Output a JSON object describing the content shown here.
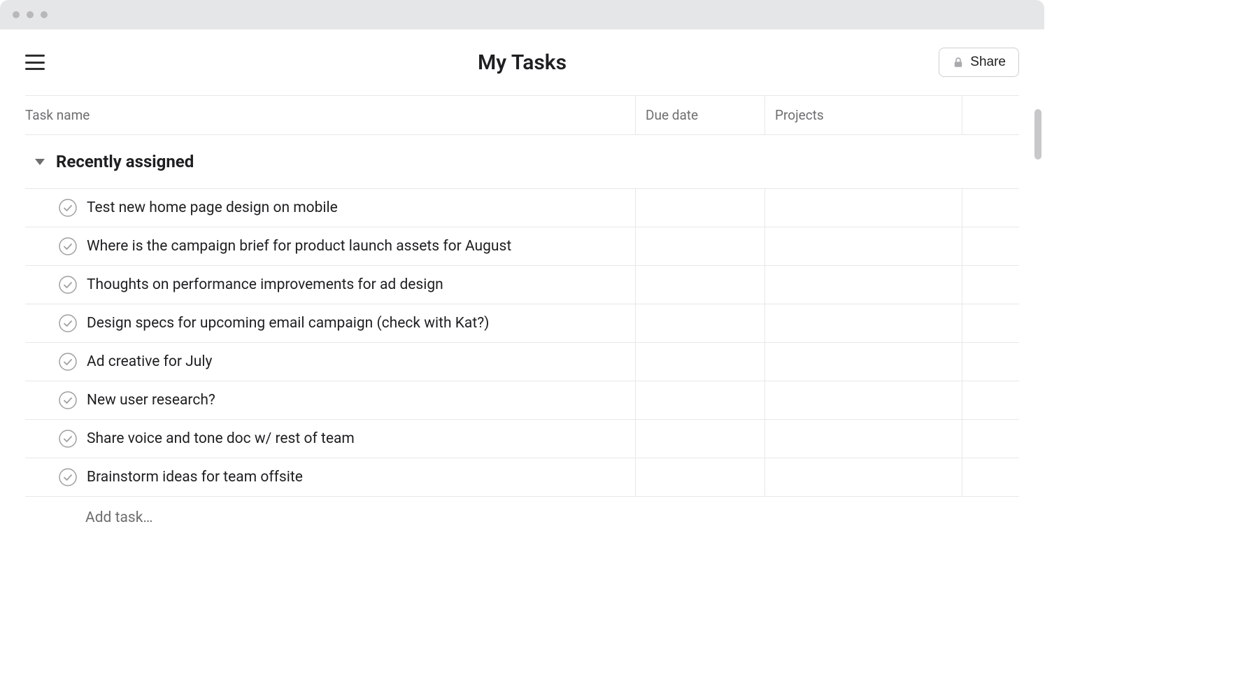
{
  "header": {
    "title": "My Tasks",
    "share_label": "Share"
  },
  "columns": {
    "task_name": "Task name",
    "due_date": "Due date",
    "projects": "Projects"
  },
  "section": {
    "title": "Recently assigned",
    "tasks": [
      {
        "name": "Test new home page design on mobile"
      },
      {
        "name": "Where is the campaign brief for product launch assets for August"
      },
      {
        "name": "Thoughts on performance improvements for ad design"
      },
      {
        "name": "Design specs for upcoming email campaign (check with Kat?)"
      },
      {
        "name": "Ad creative for July"
      },
      {
        "name": "New user research?"
      },
      {
        "name": "Share voice and tone doc w/ rest of team"
      },
      {
        "name": "Brainstorm ideas for team offsite"
      }
    ]
  },
  "add_task_placeholder": "Add task…"
}
